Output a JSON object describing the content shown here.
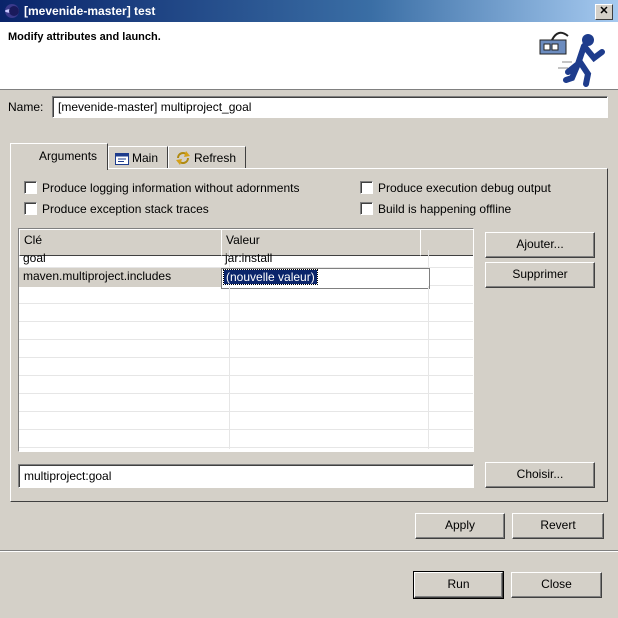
{
  "window": {
    "title": "[mevenide-master] test",
    "close_glyph": "✕"
  },
  "header": {
    "message": "Modify attributes and launch."
  },
  "name": {
    "label": "Name:",
    "value": "[mevenide-master] multiproject_goal"
  },
  "tabs": [
    {
      "label": "Arguments",
      "icon": "none",
      "active": true
    },
    {
      "label": "Main",
      "icon": "window-icon",
      "active": false
    },
    {
      "label": "Refresh",
      "icon": "refresh-icon",
      "active": false
    }
  ],
  "options": {
    "logging": "Produce logging information without adornments",
    "stack_traces": "Produce exception stack traces",
    "debug_output": "Produce execution debug output",
    "offline": "Build is happening offline"
  },
  "table": {
    "columns": [
      "Clé",
      "Valeur"
    ],
    "rows": [
      {
        "key": "goal",
        "value": "jar:install"
      },
      {
        "key": "maven.multiproject.includes",
        "value": "(nouvelle valeur)",
        "editing": true
      }
    ]
  },
  "buttons": {
    "add": "Ajouter...",
    "remove": "Supprimer",
    "choose": "Choisir...",
    "apply": "Apply",
    "revert": "Revert",
    "run": "Run",
    "close": "Close"
  },
  "goal_field": {
    "value": "multiproject:goal"
  },
  "colors": {
    "title_start": "#0a246a",
    "selection": "#0a246a",
    "face": "#d4d0c8"
  }
}
